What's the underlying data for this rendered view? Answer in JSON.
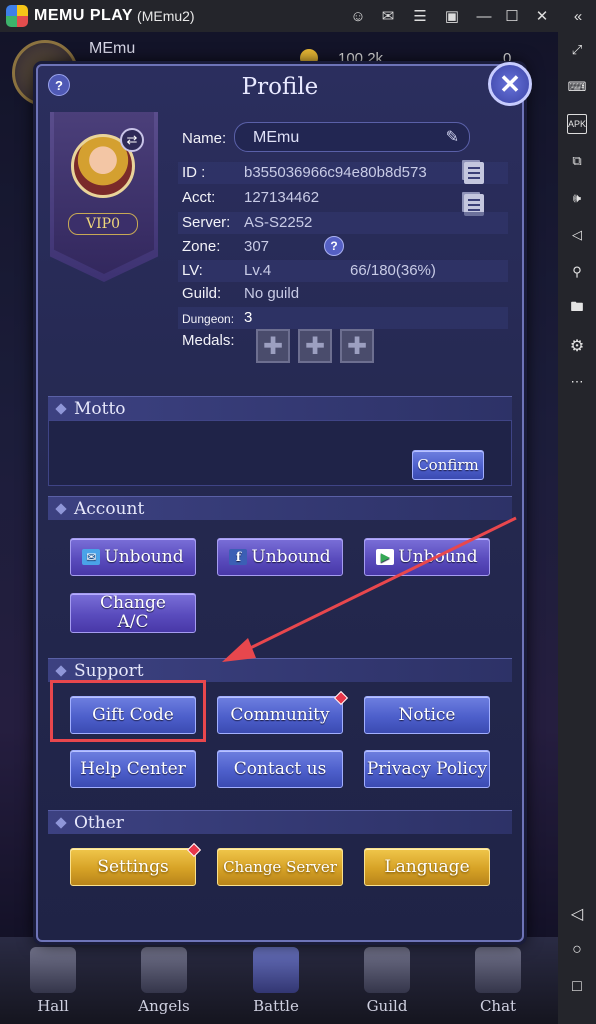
{
  "emulator": {
    "brand": "MEMU PLAY",
    "instance": "(MEmu2)",
    "title_icons": [
      "account-icon",
      "mail-icon",
      "menu-icon",
      "screenshot-icon",
      "minimize-icon",
      "maximize-icon",
      "close-icon",
      "collapse-icon"
    ],
    "side_icons": [
      "fullscreen-icon",
      "keyboard-icon",
      "apk-icon",
      "multi-window-icon",
      "volume-up-icon",
      "volume-down-icon",
      "location-icon",
      "folder-icon",
      "settings-icon",
      "more-icon",
      "back-icon",
      "home-icon",
      "recent-apps-icon"
    ],
    "apk_label": "APK"
  },
  "game": {
    "player_name": "MEmu",
    "currency_amount": "100.2k",
    "currency_amount2": "0"
  },
  "profile": {
    "title": "Profile",
    "vip": "VIP0",
    "name_label": "Name:",
    "name_value": "MEmu",
    "id_label": "ID  :",
    "id_value": "b355036966c94e80b8d573",
    "acct_label": "Acct:",
    "acct_value": "127134462",
    "server_label": "Server:",
    "server_value": "AS-S2252",
    "zone_label": "Zone:",
    "zone_value": "307",
    "lv_label": "LV:",
    "lv_value": "Lv.4",
    "exp_value": "66/180(36%)",
    "guild_label": "Guild:",
    "guild_value": "No guild",
    "dungeon_label": "Dungeon:",
    "dungeon_value": "3",
    "medals_label": "Medals:",
    "help_symbol": "?",
    "close_symbol": "✕"
  },
  "motto": {
    "header": "Motto",
    "confirm": "Confirm"
  },
  "account": {
    "header": "Account",
    "email_unbound": "Unbound",
    "facebook_unbound": "Unbound",
    "google_unbound": "Unbound",
    "change_ac": "Change A/C"
  },
  "support": {
    "header": "Support",
    "gift_code": "Gift Code",
    "community": "Community",
    "notice": "Notice",
    "help_center": "Help Center",
    "contact_us": "Contact us",
    "privacy_policy": "Privacy Policy"
  },
  "other": {
    "header": "Other",
    "settings": "Settings",
    "change_server": "Change Server",
    "language": "Language"
  },
  "nav": {
    "hall": "Hall",
    "angels": "Angels",
    "battle": "Battle",
    "guild": "Guild",
    "chat": "Chat"
  },
  "colors": {
    "highlight": "#e8474d",
    "arrow": "#e8474d",
    "panel": "#24284f"
  }
}
